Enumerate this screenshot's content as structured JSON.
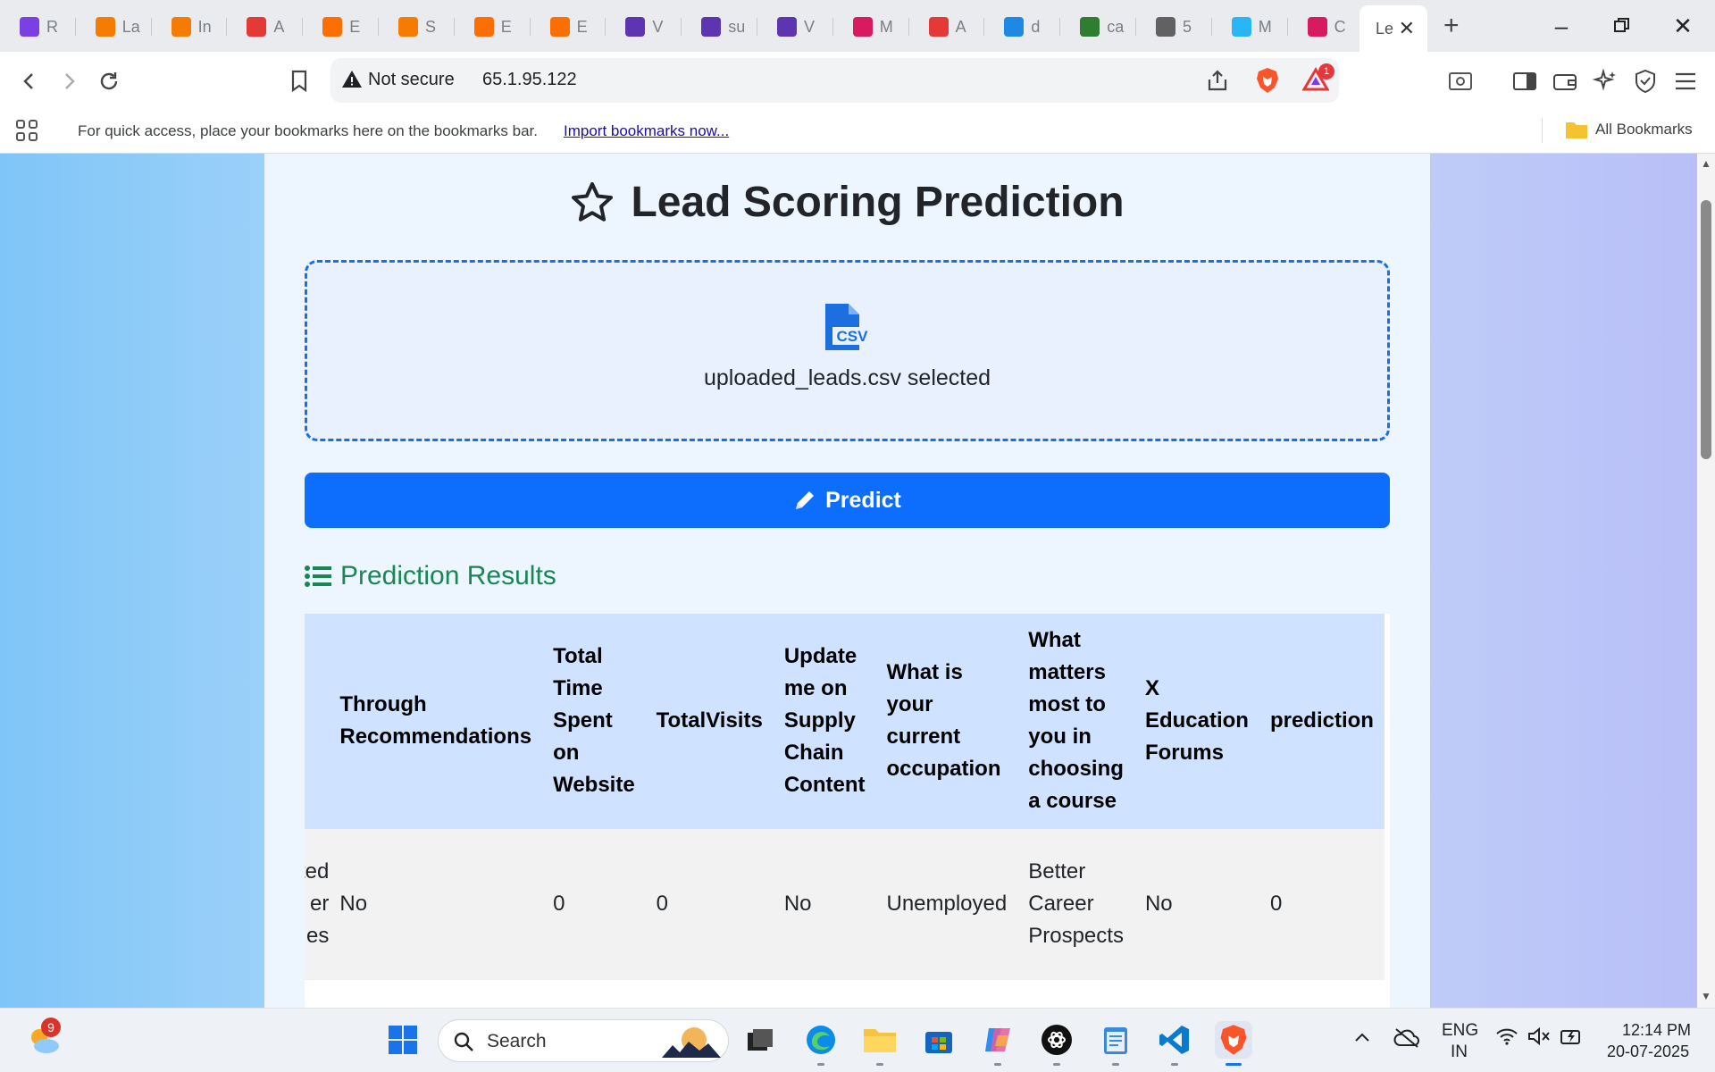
{
  "browser": {
    "tabs": [
      {
        "label": "R",
        "color": "#7b3fe4"
      },
      {
        "label": "La",
        "color": "#f57c00"
      },
      {
        "label": "In",
        "color": "#f57c00"
      },
      {
        "label": "A",
        "color": "#e53935"
      },
      {
        "label": "E",
        "color": "#ff6f00"
      },
      {
        "label": "S",
        "color": "#f57c00"
      },
      {
        "label": "E",
        "color": "#ff6f00"
      },
      {
        "label": "E",
        "color": "#ff6f00"
      },
      {
        "label": "V",
        "color": "#5e35b1"
      },
      {
        "label": "su",
        "color": "#5e35b1"
      },
      {
        "label": "V",
        "color": "#5e35b1"
      },
      {
        "label": "M",
        "color": "#d81b60"
      },
      {
        "label": "A",
        "color": "#e53935"
      },
      {
        "label": "d",
        "color": "#1e88e5"
      },
      {
        "label": "ca",
        "color": "#2e7d32"
      },
      {
        "label": "5",
        "color": "#616161"
      },
      {
        "label": "M",
        "color": "#29b6f6"
      },
      {
        "label": "C",
        "color": "#d81b60"
      }
    ],
    "active_tab_label": "Le",
    "security_label": "Not secure",
    "url": "65.1.95.122",
    "brave_badge": "1",
    "bookmarks_hint": "For quick access, place your bookmarks here on the bookmarks bar.",
    "import_link": "Import bookmarks now...",
    "all_bookmarks": "All Bookmarks"
  },
  "page": {
    "title": "Lead Scoring Prediction",
    "file_selected": "uploaded_leads.csv selected",
    "csv_icon_text": "CSV",
    "predict_label": "Predict",
    "results_heading": "Prediction Results",
    "table": {
      "headers": [
        "",
        "Through Recommendations",
        "Total Time Spent on Website",
        "TotalVisits",
        "Update me on Supply Chain Content",
        "What is your current occupation",
        "What matters most to you in choosing a course",
        "X Education Forums",
        "prediction"
      ],
      "rows": [
        [
          "sted er es",
          "No",
          "0",
          "0",
          "No",
          "Unemployed",
          "Better Career Prospects",
          "No",
          "0"
        ]
      ]
    }
  },
  "taskbar": {
    "weather_badge": "9",
    "search_label": "Search",
    "lang": "ENG",
    "region": "IN",
    "time": "12:14 PM",
    "date": "20-07-2025"
  }
}
